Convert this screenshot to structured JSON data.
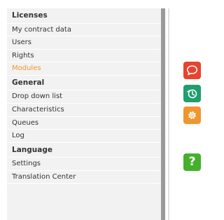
{
  "sidebar": {
    "licenses": {
      "title": "Licenses",
      "items": [
        "My contract data",
        "Users",
        "Rights",
        "Modules"
      ],
      "active": "Modules"
    },
    "general": {
      "title": "General",
      "items": [
        "Drop down list",
        "Characteristics",
        "Queues",
        "Log"
      ]
    },
    "language": {
      "title": "Language",
      "items": [
        "Settings",
        "Translation Center"
      ]
    }
  },
  "right_rail": {
    "buttons": [
      {
        "icon": "chat-bubble-icon",
        "color": "#e8432e"
      },
      {
        "icon": "history-clock-icon",
        "color": "#1f9e6e"
      },
      {
        "icon": "gear-icon",
        "color": "#f0962e"
      },
      {
        "icon": "help-icon",
        "color": "#45b02c",
        "label": "?"
      }
    ]
  },
  "colors": {
    "sidebar_bg": "#f2f2f2",
    "active_item": "#f0962e",
    "scrollbar": "#9a9a9a"
  }
}
